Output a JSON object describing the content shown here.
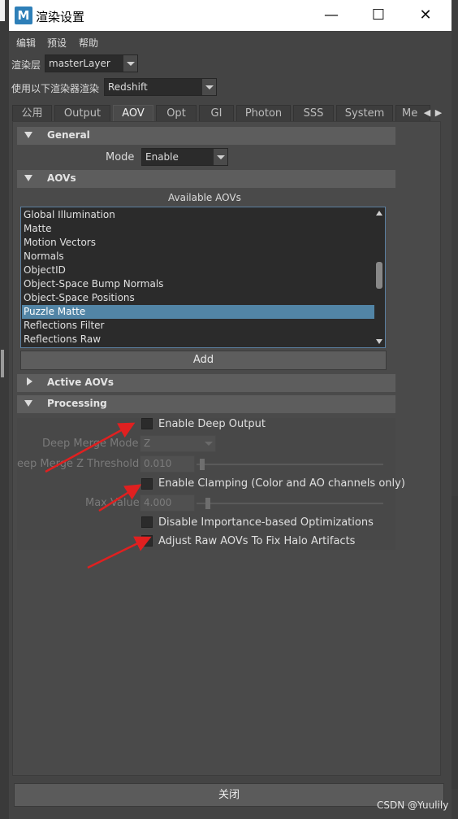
{
  "window": {
    "title": "渲染设置",
    "logo": "M",
    "minimize_glyph": "—",
    "maximize_glyph": "☐",
    "close_glyph": "✕"
  },
  "menu": [
    "编辑",
    "预设",
    "帮助"
  ],
  "render_layer": {
    "label": "渲染层",
    "value": "masterLayer"
  },
  "renderer": {
    "label": "使用以下渲染器渲染",
    "value": "Redshift"
  },
  "tabs": [
    "公用",
    "Output",
    "AOV",
    "Opt",
    "GI",
    "Photon",
    "SSS",
    "System",
    "Me"
  ],
  "active_tab": "AOV",
  "tab_arrows": {
    "left": "◀",
    "right": "▶"
  },
  "general": {
    "header": "General",
    "mode_label": "Mode",
    "mode_value": "Enable"
  },
  "aovs": {
    "header": "AOVs",
    "available_label": "Available AOVs",
    "items": [
      "Global Illumination",
      "Matte",
      "Motion Vectors",
      "Normals",
      "ObjectID",
      "Object-Space Bump Normals",
      "Object-Space Positions",
      "Puzzle Matte",
      "Reflections Filter",
      "Reflections Raw"
    ],
    "selected": "Puzzle Matte",
    "add_label": "Add"
  },
  "active_aovs": {
    "header": "Active AOVs"
  },
  "processing": {
    "header": "Processing",
    "enable_deep_output": "Enable Deep Output",
    "deep_merge_mode_label": "Deep Merge Mode",
    "deep_merge_mode_value": "Z",
    "deep_merge_z_threshold_label": "eep Merge Z Threshold",
    "deep_merge_z_threshold_value": "0.010",
    "enable_clamping": "Enable Clamping (Color and AO channels only)",
    "max_value_label": "Max Value",
    "max_value_value": "4.000",
    "disable_importance": "Disable Importance-based Optimizations",
    "adjust_raw_aovs": "Adjust Raw AOVs To Fix Halo Artifacts"
  },
  "close_label": "关闭",
  "watermark": "CSDN @Yuulily",
  "colors": {
    "arrow": "#e02020",
    "selection": "#5285a6",
    "accent": "#2e7fb8"
  }
}
